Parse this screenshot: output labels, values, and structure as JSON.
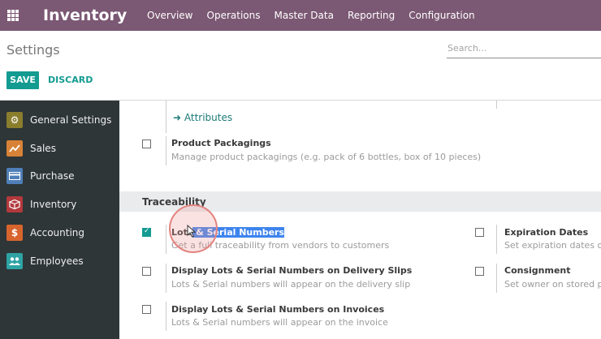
{
  "topbar": {
    "app_title": "Inventory",
    "menu": [
      "Overview",
      "Operations",
      "Master Data",
      "Reporting",
      "Configuration"
    ]
  },
  "control": {
    "breadcrumb": "Settings",
    "search_placeholder": "Search...",
    "save_label": "SAVE",
    "discard_label": "DISCARD"
  },
  "sidebar": {
    "items": [
      {
        "label": "General Settings",
        "icon": "gear-icon",
        "color": "#8a7d2c"
      },
      {
        "label": "Sales",
        "icon": "chart-icon",
        "color": "#d88237"
      },
      {
        "label": "Purchase",
        "icon": "credit-card-icon",
        "color": "#4f7fb8"
      },
      {
        "label": "Inventory",
        "icon": "box-icon",
        "color": "#b2393d"
      },
      {
        "label": "Accounting",
        "icon": "dollar-icon",
        "color": "#d8642d"
      },
      {
        "label": "Employees",
        "icon": "people-icon",
        "color": "#2ea3a4"
      }
    ]
  },
  "content": {
    "attributes_link": "Attributes",
    "product_packagings": {
      "label": "Product Packagings",
      "desc": "Manage product packagings (e.g. pack of 6 bottles, box of 10 pieces)"
    },
    "section_title": "Traceability",
    "lots": {
      "label_pre": "Lots",
      "label_selected": " & Serial Numbers",
      "desc": "Get a full traceability from vendors to customers",
      "checked": true
    },
    "expiration": {
      "label": "Expiration Dates",
      "desc": "Set expiration dates on l"
    },
    "delivery_slips": {
      "label": "Display Lots & Serial Numbers on Delivery Slips",
      "desc": "Lots & Serial numbers will appear on the delivery slip"
    },
    "consignment": {
      "label": "Consignment",
      "desc": "Set owner on stored pro"
    },
    "invoices": {
      "label": "Display Lots & Serial Numbers on Invoices",
      "desc": "Lots & Serial numbers will appear on the invoice"
    }
  },
  "colors": {
    "topbar": "#7b5873",
    "accent": "#139b91",
    "sidebar": "#2e3638"
  }
}
